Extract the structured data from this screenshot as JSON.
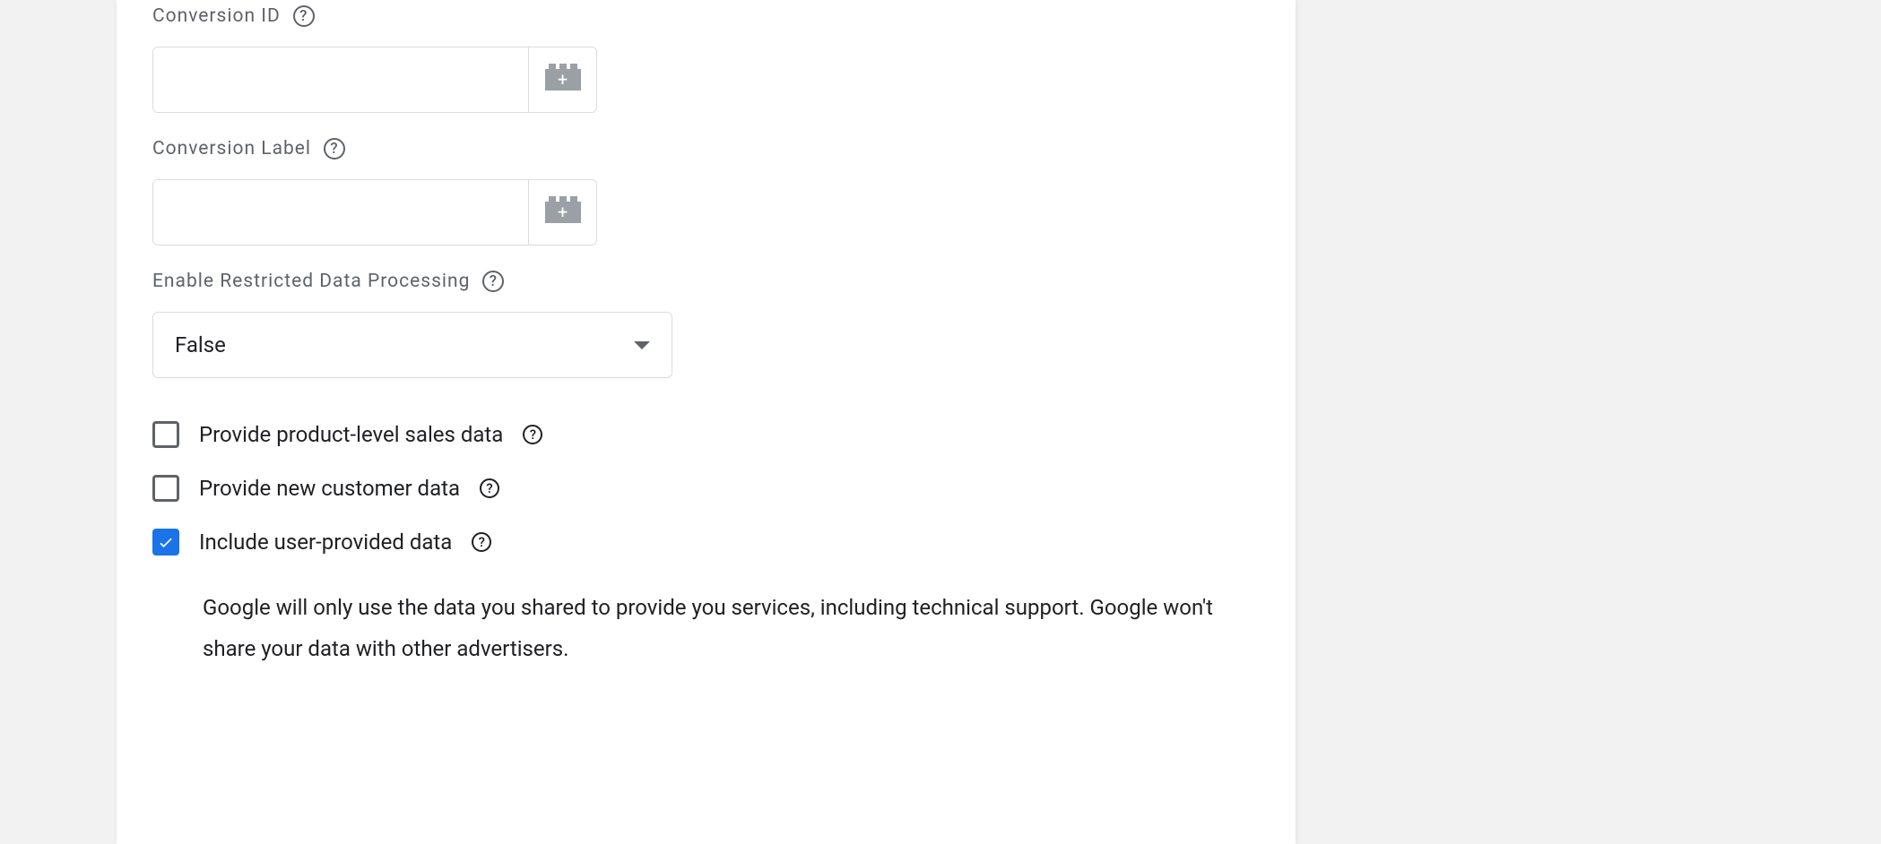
{
  "fields": {
    "conversion_id": {
      "label": "Conversion ID",
      "value": ""
    },
    "conversion_label": {
      "label": "Conversion Label",
      "value": ""
    },
    "restricted_data": {
      "label": "Enable Restricted Data Processing",
      "selected": "False"
    }
  },
  "checkboxes": {
    "product_sales": {
      "label": "Provide product-level sales data",
      "checked": false
    },
    "new_customer": {
      "label": "Provide new customer data",
      "checked": false
    },
    "user_provided": {
      "label": "Include user-provided data",
      "checked": true,
      "description": "Google will only use the data you shared to provide you services, including technical support. Google won't share your data with other advertisers."
    }
  }
}
